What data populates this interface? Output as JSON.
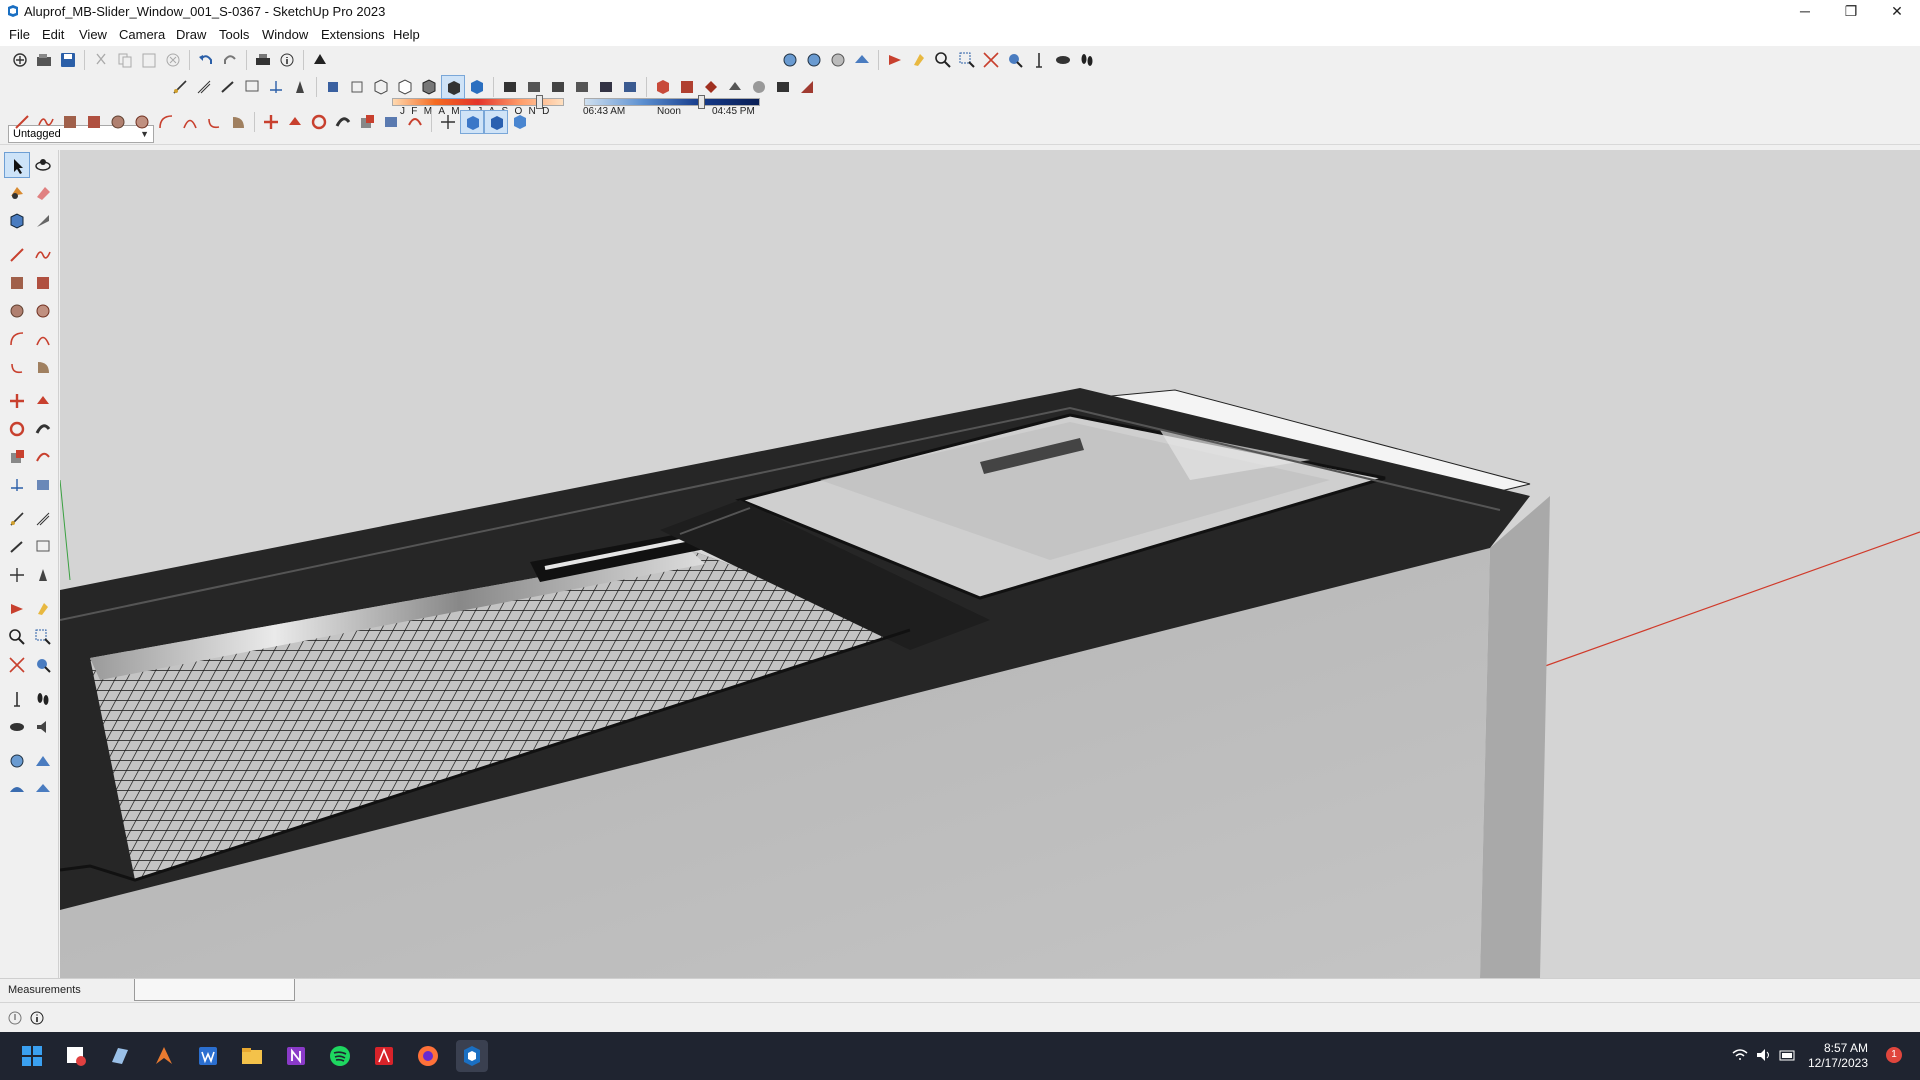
{
  "window": {
    "title": "Aluprof_MB-Slider_Window_001_S-0367 - SketchUp Pro 2023",
    "minimize": "─",
    "restore": "❐",
    "close": "✕"
  },
  "menu": [
    "File",
    "Edit",
    "View",
    "Camera",
    "Draw",
    "Tools",
    "Window",
    "Extensions",
    "Help"
  ],
  "tag_select": {
    "value": "Untagged"
  },
  "shadows": {
    "months": "JFMAMJJASOND",
    "month_fraction": 0.84,
    "time_fraction": 0.65,
    "sunrise": "06:43 AM",
    "noon": "Noon",
    "sunset": "04:45 PM"
  },
  "measurements": {
    "label": "Measurements",
    "value": ""
  },
  "taskbar": {
    "time": "8:57 AM",
    "date": "12/17/2023",
    "notifications": "1"
  },
  "colors": {
    "viewport_bg": "#d4d4d4",
    "frame": "#2a2a2a",
    "red_axis": "#d03a2a",
    "green_axis": "#3aa040",
    "taskbar": "#1f2430"
  }
}
